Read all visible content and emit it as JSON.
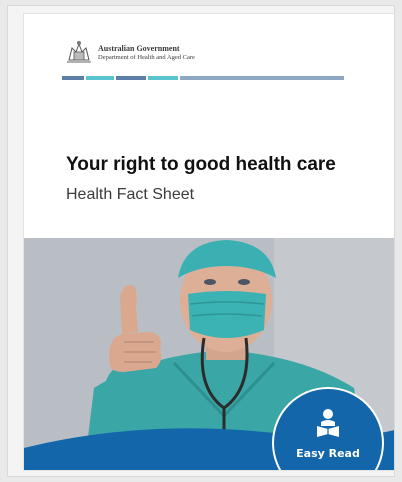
{
  "header": {
    "gov_name": "Australian Government",
    "department": "Department of Health and Aged Care",
    "stripe_colors": [
      "#5b7fa6",
      "#ffffff",
      "#59c3d0",
      "#ffffff",
      "#5b7fa6",
      "#ffffff",
      "#59c3d0",
      "#ffffff",
      "#8ea7c2"
    ]
  },
  "document": {
    "title": "Your right to good health care",
    "subtitle": "Health Fact Sheet"
  },
  "badge": {
    "label": "Easy Read",
    "icon": "reader-icon",
    "color": "#1266a9"
  },
  "cover_image": {
    "icon": "doctor-thumbs-up-photo"
  }
}
